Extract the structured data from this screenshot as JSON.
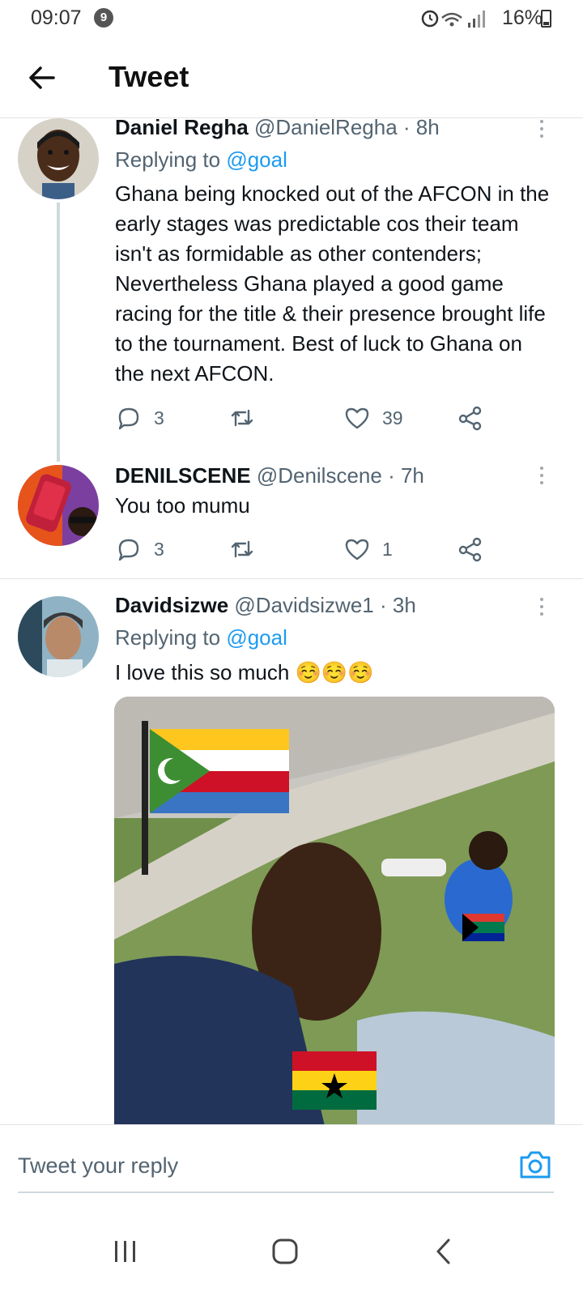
{
  "status_bar": {
    "time": "09:07",
    "notification_count": "9",
    "battery": "16%"
  },
  "header": {
    "title": "Tweet"
  },
  "tweets": [
    {
      "name": "Daniel Regha",
      "handle": "@DanielRegha",
      "time": "· 8h",
      "replying_label": "Replying to",
      "replying_to": "@goal",
      "text": "Ghana being knocked out of the AFCON in the early stages was predictable cos their team isn't as formidable as other contenders; Nevertheless Ghana played a good game racing for the title & their presence brought life to the tournament. Best of luck to Ghana on the next AFCON.",
      "replies": "3",
      "likes": "39"
    },
    {
      "name": "DENILSCENE",
      "handle": "@Denilscene",
      "time": "· 7h",
      "text": "You too mumu",
      "replies": "3",
      "likes": "1"
    },
    {
      "name": "Davidsizwe",
      "handle": "@Davidsizwe1",
      "time": "· 3h",
      "replying_label": "Replying to",
      "replying_to": "@goal",
      "text": "I love this so much ☺️☺️☺️"
    }
  ],
  "composer": {
    "placeholder": "Tweet your reply"
  },
  "colors": {
    "link": "#1d9bf0",
    "secondary_text": "#536471",
    "divider": "#e3e3e3"
  },
  "icons": [
    "back-arrow-icon",
    "more-icon",
    "reply-icon",
    "retweet-icon",
    "like-icon",
    "share-icon",
    "camera-icon",
    "recent-apps-icon",
    "home-icon",
    "back-nav-icon"
  ]
}
